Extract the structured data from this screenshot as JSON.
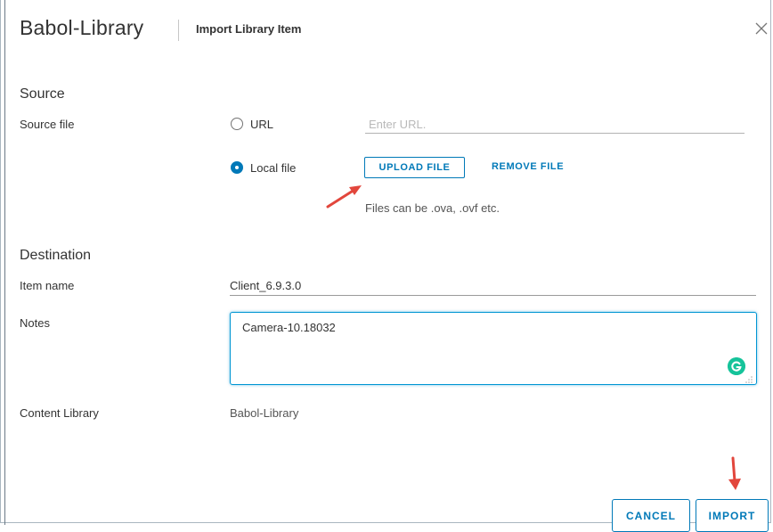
{
  "header": {
    "app_title": "Babol-Library",
    "dialog_title": "Import Library Item",
    "close_icon": "close-icon"
  },
  "source": {
    "heading": "Source",
    "source_file_label": "Source file",
    "url_option_label": "URL",
    "url_placeholder": "Enter URL.",
    "url_selected": false,
    "local_file_option_label": "Local file",
    "local_file_selected": true,
    "upload_button_label": "UPLOAD FILE",
    "remove_button_label": "REMOVE FILE",
    "hint": "Files can be .ova, .ovf etc."
  },
  "destination": {
    "heading": "Destination",
    "item_name_label": "Item name",
    "item_name_value": "Client_6.9.3.0",
    "notes_label": "Notes",
    "notes_value": "Camera-10.18032",
    "content_library_label": "Content Library",
    "content_library_value": "Babol-Library"
  },
  "footer": {
    "cancel_label": "CANCEL",
    "import_label": "IMPORT"
  },
  "colors": {
    "accent": "#0079b8",
    "annotation_arrow": "#e2463c",
    "grammarly": "#15c39a"
  }
}
